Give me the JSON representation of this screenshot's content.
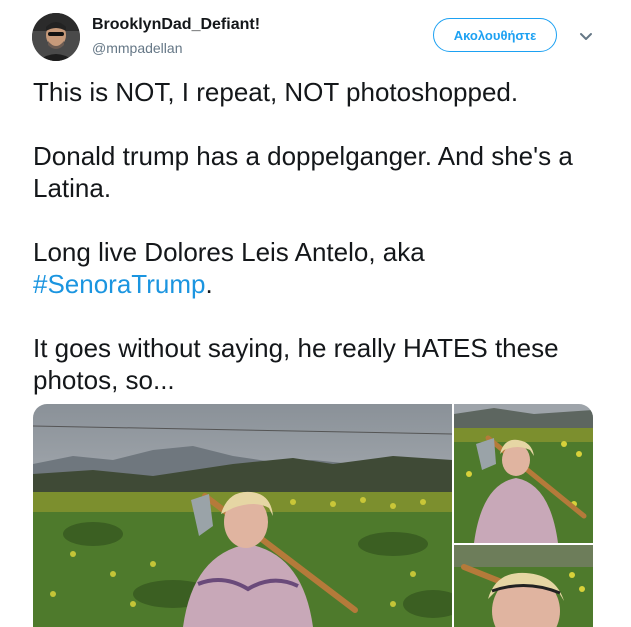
{
  "author": {
    "display_name": "BrooklynDad_Defiant!",
    "handle": "@mmpadellan",
    "avatar_icon": "user-avatar-photo"
  },
  "follow_button": {
    "label": "Ακολουθήστε"
  },
  "menu": {
    "icon": "chevron-down-icon"
  },
  "tweet": {
    "line1": "This is NOT, I repeat, NOT photoshopped.",
    "line2": "Donald trump has a doppelganger. And she's a Latina.",
    "line3_prefix": "Long live Dolores Leis Antelo, aka ",
    "line3_hashtag": "#SenoraTrump",
    "line3_suffix": ".",
    "line4": "It goes without saying, he really HATES these photos, so..."
  },
  "colors": {
    "accent": "#1da1f2",
    "hashtag": "#1b95e0",
    "text": "#14171a",
    "muted": "#657786"
  }
}
